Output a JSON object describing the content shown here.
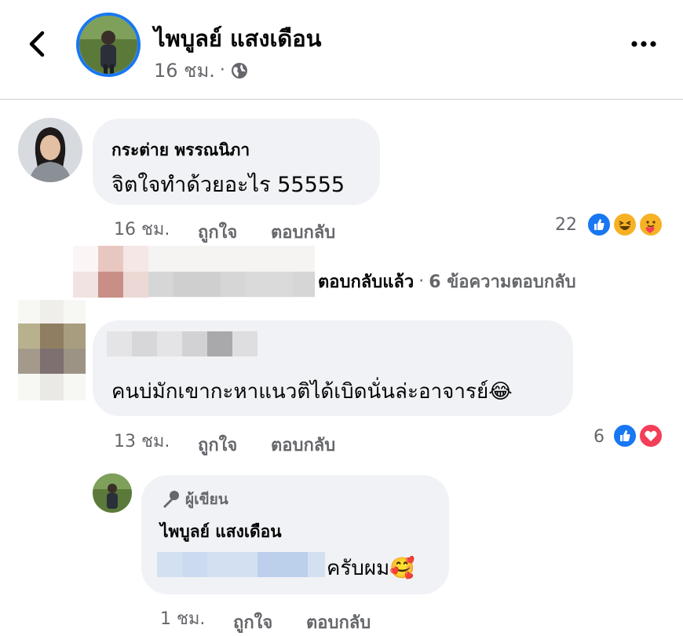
{
  "header": {
    "back_icon": "chevron-left-icon",
    "author_name": "ไพบูลย์ แสงเดือน",
    "time": "16 ชม.",
    "separator": "·",
    "privacy_icon": "globe-icon",
    "more_icon": "more-dots-icon"
  },
  "comments": [
    {
      "name": "กระต่าย พรรณนิภา",
      "text": "จิตใจทำด้วยอะไร 55555",
      "time": "16 ชม.",
      "like_label": "ถูกใจ",
      "reply_label": "ตอบกลับ",
      "reaction_count": "22",
      "reactions": [
        "like-reaction-icon",
        "haha-reaction-icon",
        "care-reaction-icon"
      ]
    },
    {
      "name": "",
      "text": "คนบ่มักเขากะหาแนวติได้เบิดนั่นล่ะอาจารย์😂",
      "time": "13 ชม.",
      "like_label": "ถูกใจ",
      "reply_label": "ตอบกลับ",
      "reaction_count": "6",
      "reactions": [
        "like-reaction-icon",
        "love-reaction-icon"
      ]
    }
  ],
  "replies_summary": {
    "text": "ตอบกลับแล้ว",
    "separator": "·",
    "count_text": "6 ข้อความตอบกลับ"
  },
  "author_reply": {
    "badge_icon": "microphone-icon",
    "badge": "ผู้เขียน",
    "name": "ไพบูลย์ แสงเดือน",
    "text": "ครับผม🥰",
    "time": "1 ชม.",
    "like_label": "ถูกใจ",
    "reply_label": "ตอบกลับ"
  },
  "colors": {
    "accent": "#1877f2",
    "bubble": "#f0f2f5",
    "meta_text": "#65676b",
    "love": "#f33e58",
    "haha": "#f7b125"
  }
}
